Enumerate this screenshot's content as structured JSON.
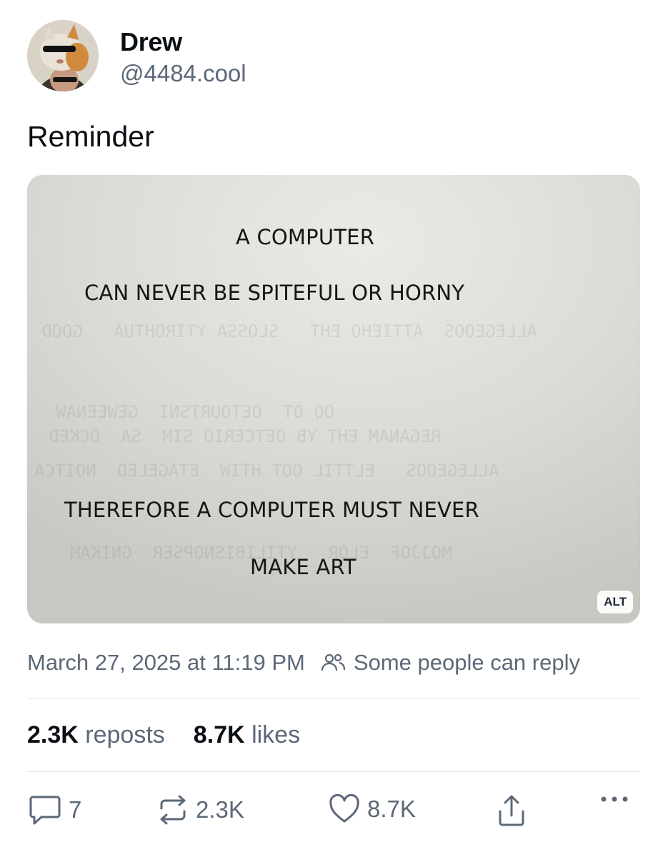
{
  "author": {
    "display_name": "Drew",
    "handle": "@4484.cool"
  },
  "post": {
    "text": "Reminder",
    "image": {
      "lines": [
        "A COMPUTER",
        "CAN NEVER BE SPITEFUL OR HORNY",
        "THEREFORE A COMPUTER MUST NEVER",
        "MAKE ART"
      ],
      "alt_badge": "ALT"
    },
    "timestamp": "March 27, 2025 at 11:19 PM",
    "reply_setting": "Some people can reply"
  },
  "stats": {
    "reposts_count": "2.3K",
    "reposts_label": "reposts",
    "likes_count": "8.7K",
    "likes_label": "likes"
  },
  "actions": {
    "reply_count": "7",
    "repost_count": "2.3K",
    "like_count": "8.7K"
  },
  "colors": {
    "secondary_text": "#5b6878",
    "divider": "#e3e7ec"
  }
}
